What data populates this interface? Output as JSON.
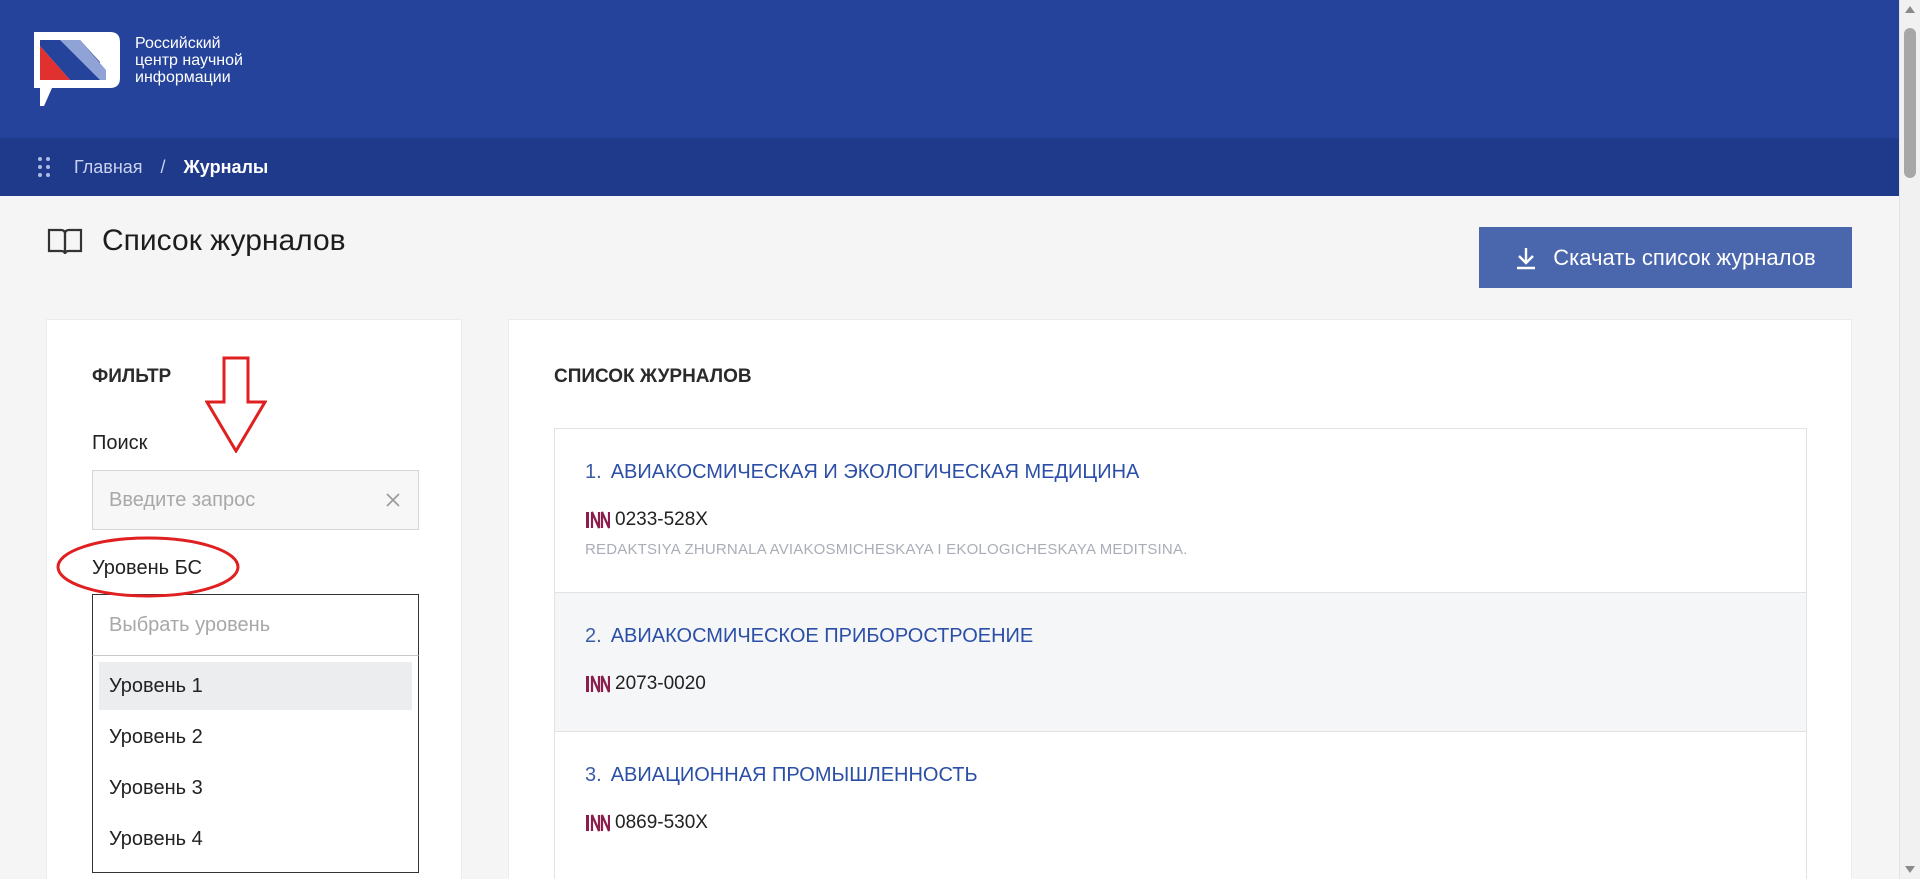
{
  "brand": {
    "logo_lines": [
      "Российский",
      "центр научной",
      "информации"
    ],
    "colors": {
      "header": "#25439a",
      "breadcrumb": "#1f3a8a",
      "accent": "#4a66ad",
      "link": "#2b4ea6",
      "issn": "#8b1e4d",
      "annotation": "#e02020"
    }
  },
  "breadcrumb": {
    "menu_icon": "grid-dots-icon",
    "home": "Главная",
    "separator": "/",
    "current": "Журналы"
  },
  "page": {
    "title": "Список журналов",
    "title_icon": "open-book-icon",
    "download_button": "Скачать список журналов",
    "download_icon": "download-icon"
  },
  "filter": {
    "title": "ФИЛЬТР",
    "search_label": "Поиск",
    "search_placeholder": "Введите запрос",
    "search_value": "",
    "level_label": "Уровень БС",
    "level_placeholder": "Выбрать уровень",
    "level_options": [
      "Уровень 1",
      "Уровень 2",
      "Уровень 3",
      "Уровень 4"
    ],
    "highlighted_option": "Уровень 1"
  },
  "list": {
    "title": "СПИСОК ЖУРНАЛОВ",
    "journals": [
      {
        "num": "1.",
        "title": "АВИАКОСМИЧЕСКАЯ И ЭКОЛОГИЧЕСКАЯ МЕДИЦИНА",
        "issn": "0233-528X",
        "publisher": "REDAKTSIYA ZHURNALA AVIAKOSMICHESKAYA I EKOLOGICHESKAYA MEDITSINA."
      },
      {
        "num": "2.",
        "title": "АВИАКОСМИЧЕСКОЕ ПРИБОРОСТРОЕНИЕ",
        "issn": "2073-0020"
      },
      {
        "num": "3.",
        "title": "АВИАЦИОННАЯ ПРОМЫШЛЕННОСТЬ",
        "issn": "0869-530X"
      }
    ]
  }
}
